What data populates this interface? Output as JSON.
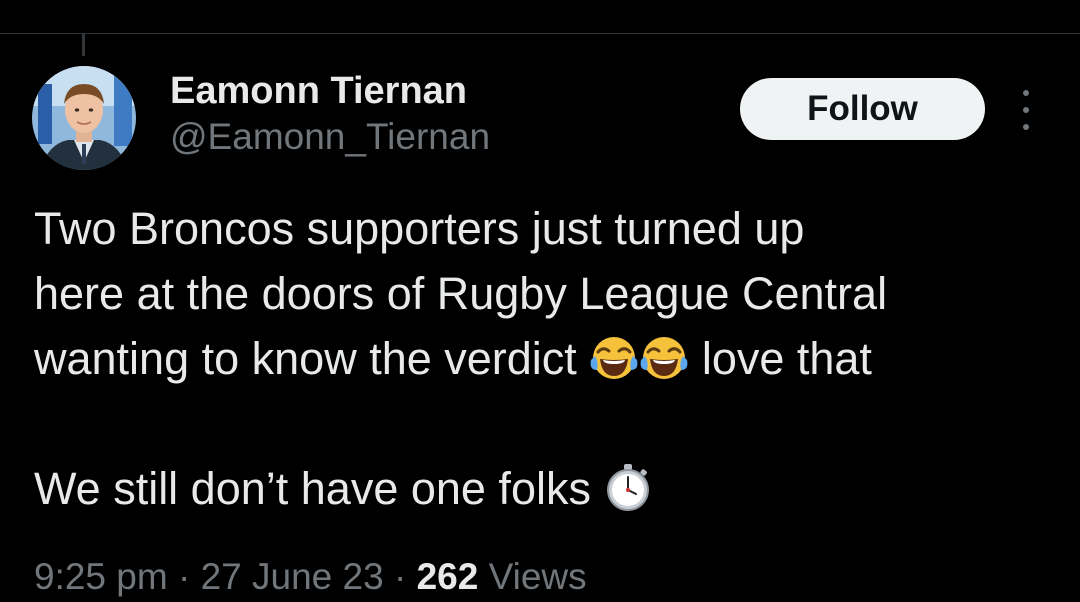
{
  "colors": {
    "background": "#000000",
    "primary_text": "#e7e9ea",
    "secondary_text": "#71767b",
    "follow_button_bg": "#eff3f4",
    "follow_button_text": "#0f1419",
    "divider": "#2f3336"
  },
  "author": {
    "display_name": "Eamonn Tiernan",
    "handle": "@Eamonn_Tiernan",
    "avatar_icon": "profile-photo"
  },
  "actions": {
    "follow_label": "Follow",
    "more_icon": "more-vertical-icon"
  },
  "tweet": {
    "line1": "Two Broncos supporters just turned up",
    "line2": "here at the doors of Rugby League Central",
    "line3_text": "wanting to know the verdict",
    "line3_emoji_icon": "face-with-tears-of-joy-icon",
    "line3_tail": " love that",
    "line4_text": "We still don’t have one folks",
    "line4_emoji_icon": "stopwatch-icon"
  },
  "meta": {
    "time": "9:25 pm",
    "separator": "·",
    "date": "27 June 23",
    "views_count": "262",
    "views_label": "Views"
  }
}
